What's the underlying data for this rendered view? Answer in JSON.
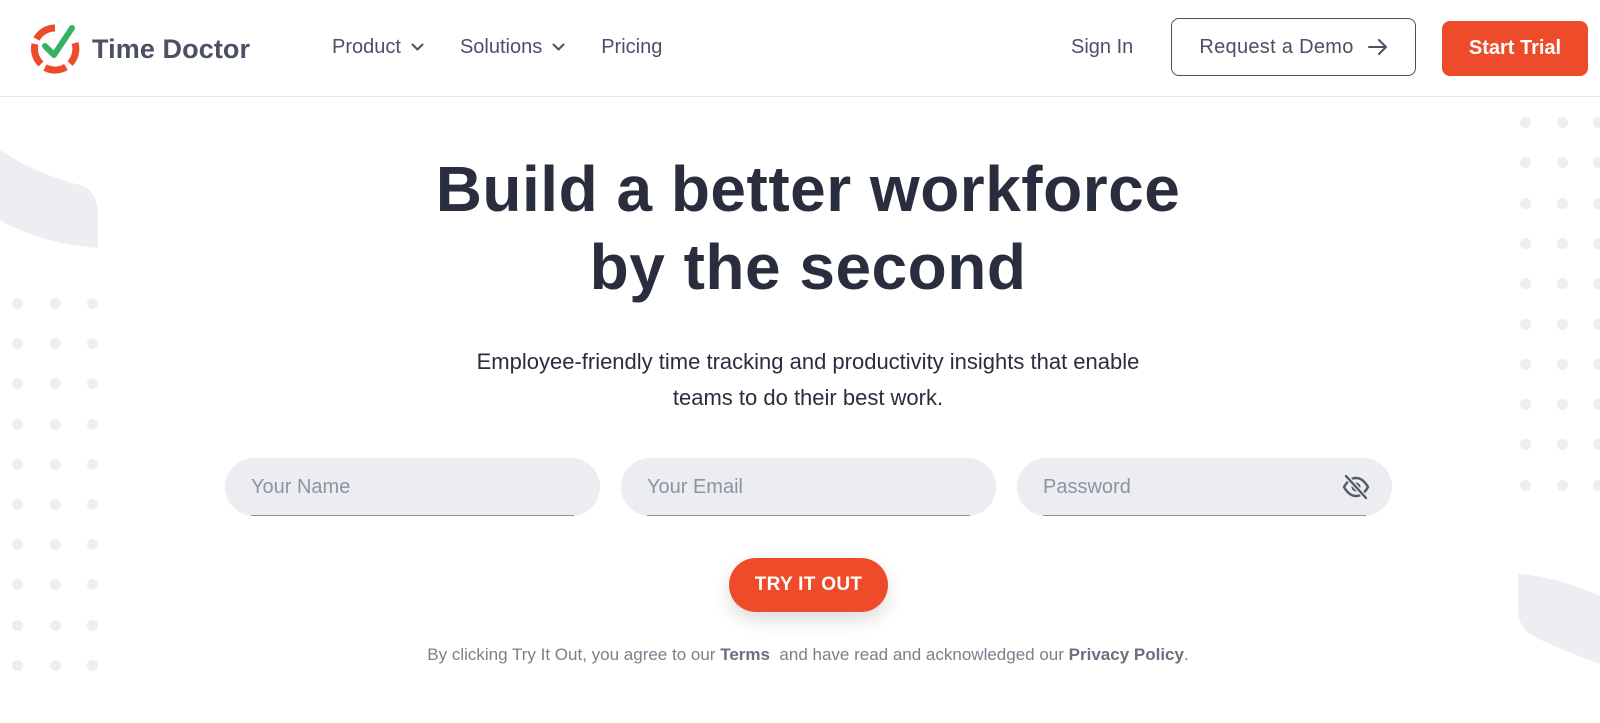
{
  "brand": {
    "name": "Time Doctor",
    "accent_color": "#ee4b2a",
    "check_color": "#35b25f"
  },
  "nav": {
    "items": [
      {
        "label": "Product",
        "icon": "chevron-down-icon"
      },
      {
        "label": "Solutions",
        "icon": "chevron-down-icon"
      },
      {
        "label": "Pricing"
      }
    ],
    "sign_in": "Sign In",
    "demo_label": "Request a Demo",
    "trial_label": "Start Trial"
  },
  "hero": {
    "title_line1": "Build a better workforce",
    "title_line2": "by the second",
    "subtitle_line1": "Employee-friendly time tracking and productivity insights that enable",
    "subtitle_line2": "teams to do their best work."
  },
  "form": {
    "name_placeholder": "Your Name",
    "email_placeholder": "Your Email",
    "password_placeholder": "Password",
    "password_icon": "eye-off-icon",
    "submit_label": "TRY IT OUT"
  },
  "legal": {
    "prefix": "By clicking Try It Out, you agree to our",
    "terms": "Terms",
    "middle": "and have read and acknowledged our",
    "privacy": "Privacy Policy",
    "suffix": "."
  }
}
